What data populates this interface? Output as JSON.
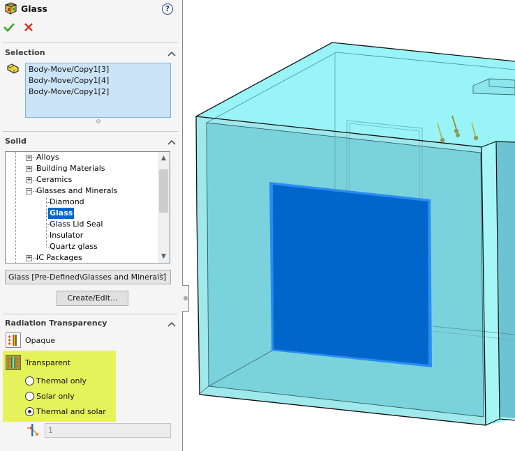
{
  "property_manager": {
    "title": "Glass",
    "title_icon": "material-icon",
    "help_icon": "question-mark",
    "help_label": "?",
    "ok_icon": "checkmark",
    "cancel_icon": "x-mark"
  },
  "selection": {
    "header": "Selection",
    "icon": "solid-body-icon",
    "items": [
      "Body-Move/Copy1[3]",
      "Body-Move/Copy1[4]",
      "Body-Move/Copy1[2]"
    ]
  },
  "solid": {
    "header": "Solid",
    "tree": [
      {
        "label": "Alloys",
        "level": 1,
        "expander": "+"
      },
      {
        "label": "Building Materials",
        "level": 1,
        "expander": "+"
      },
      {
        "label": "Ceramics",
        "level": 1,
        "expander": "+"
      },
      {
        "label": "Glasses and Minerals",
        "level": 1,
        "expander": "−"
      },
      {
        "label": "Diamond",
        "level": 2
      },
      {
        "label": "Glass",
        "level": 2,
        "selected": true
      },
      {
        "label": "Glass Lid Seal",
        "level": 2
      },
      {
        "label": "Insulator",
        "level": 2
      },
      {
        "label": "Quartz glass",
        "level": 2
      },
      {
        "label": "IC Packages",
        "level": 1,
        "expander": "+"
      }
    ],
    "material_combo": "Glass [Pre-Defined\\Glasses and Minerals]",
    "create_edit_label": "Create/Edit..."
  },
  "radiation": {
    "header": "Radiation Transparency",
    "opaque_label": "Opaque",
    "transparent_label": "Transparent",
    "options": [
      {
        "label": "Thermal only",
        "checked": false
      },
      {
        "label": "Solar only",
        "checked": false
      },
      {
        "label": "Thermal and solar",
        "checked": true
      }
    ],
    "value_placeholder": "1",
    "highlight_color": "#e6f25a"
  },
  "viewport": {
    "model_color": "#9eeef0",
    "glass_panel_color": "#0066cc"
  }
}
